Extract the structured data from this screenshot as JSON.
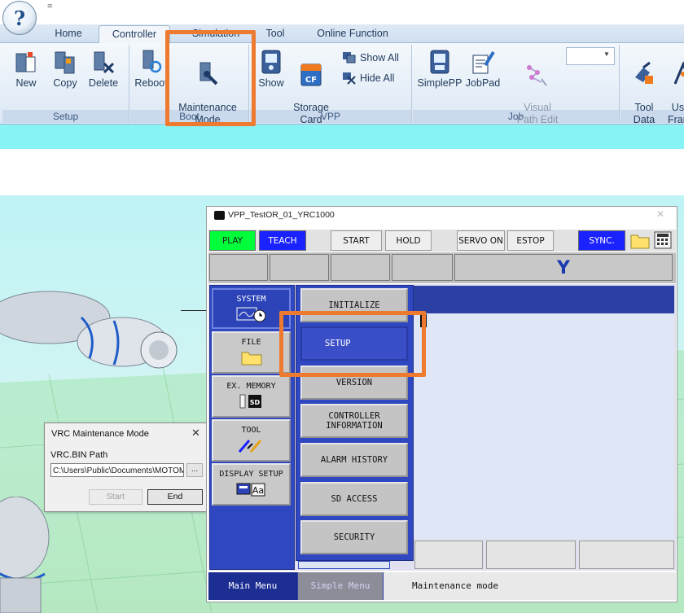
{
  "ribbon": {
    "app_orb_glyph": "?",
    "qat_glyph": "=",
    "tabs": [
      "Home",
      "Controller",
      "Simulation",
      "Tool",
      "Online Function"
    ],
    "active_tab": "Controller",
    "groups": {
      "setup": {
        "label": "Setup",
        "buttons": [
          "New",
          "Copy",
          "Delete"
        ]
      },
      "boot": {
        "label": "Boot",
        "buttons": [
          "Reboot",
          "Maintenance\nMode"
        ]
      },
      "vpp": {
        "label": "VPP",
        "buttons": [
          "Show",
          "Storage\nCard"
        ],
        "small_buttons": [
          "Show All",
          "Hide All"
        ]
      },
      "job": {
        "label": "Job",
        "buttons": [
          "SimplePP",
          "JobPad",
          "Visual\nPath Edit"
        ]
      },
      "tooldata": {
        "buttons": [
          "Tool\nData",
          "User\nFrame"
        ]
      }
    },
    "icons": {
      "new": "new-controller-icon",
      "copy": "copy-controller-icon",
      "delete": "delete-controller-icon",
      "reboot": "reboot-icon",
      "maintenance": "maintenance-mode-icon",
      "show": "pendant-show-icon",
      "storage": "storage-card-icon",
      "simplepp": "simplepp-icon",
      "jobpad": "jobpad-icon",
      "visual": "visual-path-edit-icon",
      "tool": "tool-data-icon"
    },
    "accent": "#1e395b",
    "strip_color": "#87f3f5"
  },
  "vrc_dialog": {
    "title": "VRC Maintenance Mode",
    "close_glyph": "✕",
    "path_label": "VRC.BIN Path",
    "path_value": "C:\\Users\\Public\\Documents\\MOTOMAN",
    "browse_label": "...",
    "start_label": "Start",
    "end_label": "End"
  },
  "pendant": {
    "title": "VPP_TestOR_01_YRC1000",
    "close_glyph": "✕",
    "toolbar": {
      "play": "PLAY",
      "teach": "TEACH",
      "start": "START",
      "hold": "HOLD",
      "servo_on": "SERVO ON",
      "estop": "ESTOP",
      "sync": "SYNC."
    },
    "header_glyph": "Y",
    "main_menu": [
      {
        "label": "SYSTEM",
        "icon": "system-clock-icon",
        "selected": true
      },
      {
        "label": "FILE",
        "icon": "folder-icon",
        "selected": false
      },
      {
        "label": "EX. MEMORY",
        "icon": "sd-card-icon",
        "selected": false
      },
      {
        "label": "TOOL",
        "icon": "tool-wrench-icon",
        "selected": false
      },
      {
        "label": "DISPLAY SETUP",
        "icon": "display-setup-icon",
        "selected": false
      }
    ],
    "sub_menu": [
      {
        "label": "INITIALIZE"
      },
      {
        "label": "SETUP"
      },
      {
        "label": "VERSION"
      },
      {
        "label": "CONTROLLER\nINFORMATION"
      },
      {
        "label": "ALARM HISTORY"
      },
      {
        "label": "SD ACCESS"
      },
      {
        "label": "SECURITY"
      }
    ],
    "sd_icon_text": "SD",
    "aa_icon_text": "Aa",
    "status": {
      "main_menu": "Main Menu",
      "simple_menu": "Simple Menu",
      "mode_text": "Maintenance mode"
    },
    "colors": {
      "play": "#00ff3a",
      "teach": "#1a22ff",
      "sync": "#1a22ff",
      "menu_blue": "#2f47c0",
      "selected": "#3a4ec8"
    }
  },
  "highlight_color": "#ee7a30"
}
